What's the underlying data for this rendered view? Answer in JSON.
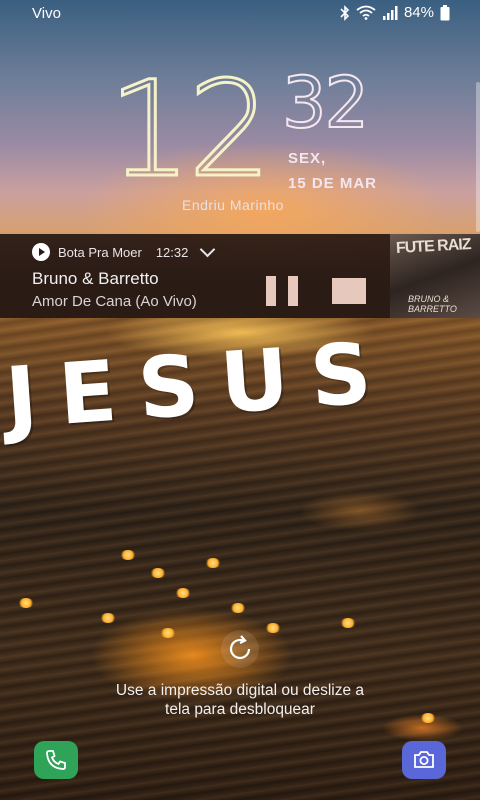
{
  "status_bar": {
    "carrier": "Vivo",
    "battery": "84%",
    "icons": [
      "bluetooth-icon",
      "wifi-icon",
      "signal-icon",
      "battery-icon"
    ]
  },
  "clock": {
    "hours": "12",
    "minutes": "32",
    "day": "SEX,",
    "date": "15 DE MAR",
    "owner": "Endriu Marinho"
  },
  "media": {
    "app_name": "Bota Pra Moer",
    "time": "12:32",
    "artist": "Bruno & Barretto",
    "track": "Amor De Cana (Ao Vivo)",
    "album_text_top": "FUTE RAIZ",
    "album_text_bottom": "BRUNO & BARRETTO",
    "controls": [
      "pause-icon",
      "stop-icon"
    ]
  },
  "wallpaper": {
    "overlay_text": "JESUS"
  },
  "unlock": {
    "line1": "Use a impressão digital ou deslize a",
    "line2": "tela para desbloquear"
  },
  "shortcuts": {
    "left": "phone-icon",
    "right": "camera-icon"
  },
  "colors": {
    "phone": "#2fa458",
    "camera": "#5a67d8",
    "media_controls": "#e6c8bc"
  }
}
